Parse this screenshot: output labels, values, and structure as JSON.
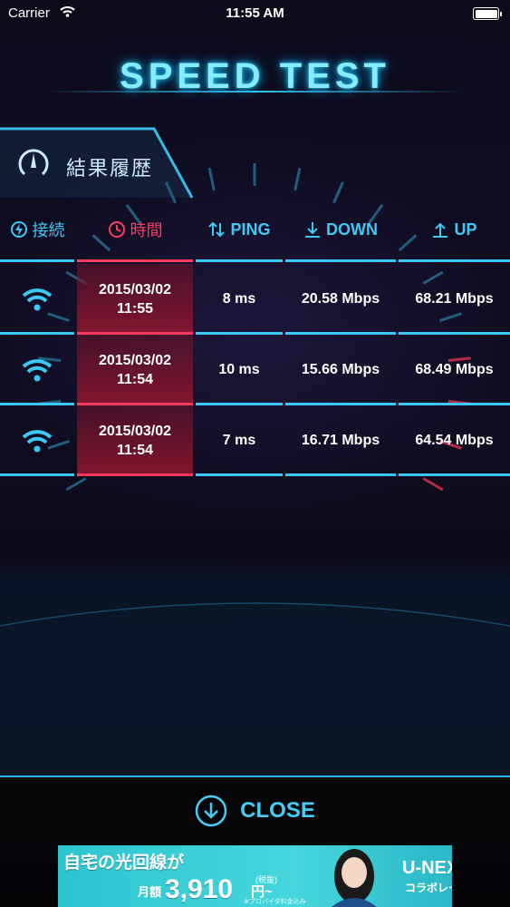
{
  "status_bar": {
    "carrier": "Carrier",
    "time": "11:55 AM"
  },
  "title": "SPEED TEST",
  "history_tab": {
    "label": "結果履歴"
  },
  "columns": {
    "connection": "接続",
    "time": "時間",
    "ping": "PING",
    "down": "DOWN",
    "up": "UP"
  },
  "rows": [
    {
      "date": "2015/03/02",
      "time": "11:55",
      "ping": "8 ms",
      "down": "20.58 Mbps",
      "up": "68.21 Mbps"
    },
    {
      "date": "2015/03/02",
      "time": "11:54",
      "ping": "10 ms",
      "down": "15.66 Mbps",
      "up": "68.49 Mbps"
    },
    {
      "date": "2015/03/02",
      "time": "11:54",
      "ping": "7 ms",
      "down": "16.71 Mbps",
      "up": "64.54 Mbps"
    }
  ],
  "close_label": "CLOSE",
  "ad": {
    "headline": "自宅の光回線が",
    "price_prefix": "月額",
    "price": "3,910",
    "price_suffix": "円~",
    "tax_note": "(税抜)",
    "footnote": "※プロバイダ料金込み",
    "brand": "U-NEXT光",
    "brand_sub": "コラボレーション"
  },
  "colors": {
    "accent_cyan": "#3cc8f4",
    "accent_red": "#ff3a5c",
    "title_glow": "#86ecff",
    "background": "#0c0b1c"
  }
}
